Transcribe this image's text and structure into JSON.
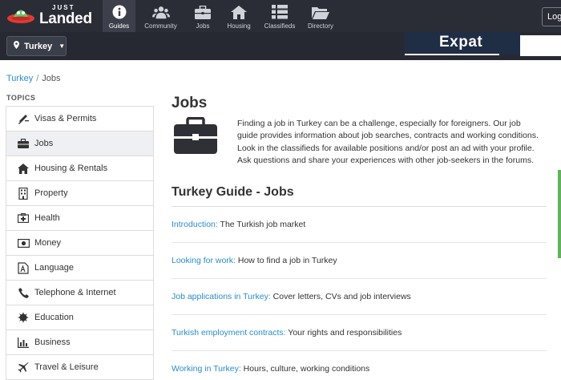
{
  "header": {
    "logo_small": "JUST",
    "logo_main": "Landed",
    "nav": [
      {
        "label": "Guides",
        "icon": "info-icon",
        "active": true
      },
      {
        "label": "Community",
        "icon": "community-icon",
        "active": false
      },
      {
        "label": "Jobs",
        "icon": "briefcase-icon",
        "active": false
      },
      {
        "label": "Housing",
        "icon": "house-icon",
        "active": false
      },
      {
        "label": "Classifieds",
        "icon": "classifieds-icon",
        "active": false
      },
      {
        "label": "Directory",
        "icon": "folder-icon",
        "active": false
      }
    ],
    "login_label": "Log"
  },
  "subbar": {
    "country": "Turkey",
    "ad_text": "Expat"
  },
  "breadcrumb": {
    "parent": "Turkey",
    "separator": "/",
    "current": "Jobs"
  },
  "sidebar": {
    "title": "TOPICS",
    "items": [
      {
        "label": "Visas & Permits",
        "icon": "passport-icon"
      },
      {
        "label": "Jobs",
        "icon": "briefcase-icon"
      },
      {
        "label": "Housing & Rentals",
        "icon": "house-icon"
      },
      {
        "label": "Property",
        "icon": "building-icon"
      },
      {
        "label": "Health",
        "icon": "first-aid-icon"
      },
      {
        "label": "Money",
        "icon": "money-icon"
      },
      {
        "label": "Language",
        "icon": "language-icon"
      },
      {
        "label": "Telephone & Internet",
        "icon": "phone-icon"
      },
      {
        "label": "Education",
        "icon": "education-icon"
      },
      {
        "label": "Business",
        "icon": "chart-icon"
      },
      {
        "label": "Travel & Leisure",
        "icon": "plane-icon"
      }
    ]
  },
  "main": {
    "title": "Jobs",
    "intro": "Finding a job in Turkey can be a challenge, especially for foreigners. Our job guide provides information about job searches, contracts and working conditions. Look in the classifieds for available positions and/or post an ad with your profile. Ask questions and share your experiences with other job-seekers in the forums.",
    "guide_title": "Turkey Guide - Jobs",
    "guide_items": [
      {
        "link": "Introduction:",
        "text": " The Turkish job market"
      },
      {
        "link": "Looking for work:",
        "text": " How to find a job in Turkey"
      },
      {
        "link": "Job applications in Turkey:",
        "text": " Cover letters, CVs and job interviews"
      },
      {
        "link": "Turkish employment contracts:",
        "text": " Your rights and responsibilities"
      },
      {
        "link": "Working in Turkey:",
        "text": " Hours, culture, working conditions"
      }
    ]
  },
  "colors": {
    "topbar": "#2b2d36",
    "link": "#2a8ccc",
    "accent_green": "#5fb35a"
  }
}
